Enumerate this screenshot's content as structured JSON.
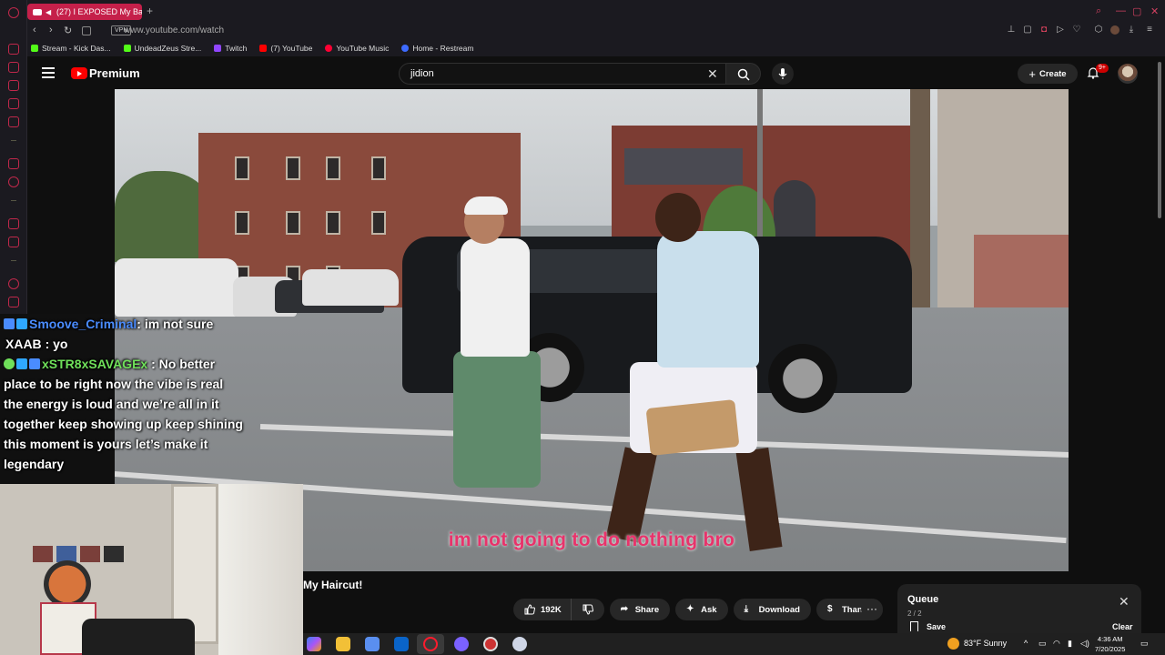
{
  "browser": {
    "tab_title": "(27) I EXPOSED My Ba",
    "url": "www.youtube.com/watch",
    "vpn_label": "VPN",
    "bookmarks": [
      {
        "label": "Stream - Kick Das...",
        "color": "#53fc18"
      },
      {
        "label": "UndeadZeus Stre...",
        "color": "#53fc18"
      },
      {
        "label": "Twitch",
        "color": "#9146ff"
      },
      {
        "label": "(7) YouTube",
        "color": "#ff0000"
      },
      {
        "label": "YouTube Music",
        "color": "#ff0033"
      },
      {
        "label": "Home - Restream",
        "color": "#3d6bff"
      }
    ]
  },
  "youtube": {
    "brand": "Premium",
    "search_value": "jidion",
    "create_label": "Create",
    "notif_badge": "9+",
    "subtitle": "im not going to do nothing bro",
    "video_title": "My Haircut!",
    "actions": {
      "likes": "192K",
      "share": "Share",
      "ask": "Ask",
      "download": "Download",
      "thanks": "Thanks",
      "more": "···"
    },
    "queue": {
      "title": "Queue",
      "count": "2 / 2",
      "save": "Save",
      "clear": "Clear"
    }
  },
  "chat": [
    {
      "user": "Smoove_Criminal",
      "message": ": im not sure",
      "user_color": "#4a8cff"
    },
    {
      "user": "XAAB",
      "message": ": yo",
      "user_color": "#ffffff"
    },
    {
      "user": "xSTR8xSAVAGEx",
      "message": ": No better place to be right now the vibe is real the energy is loud and we’re all in it together keep showing up keep shining this moment is yours let’s make it legendary",
      "user_color": "#6fe05a"
    }
  ],
  "taskbar": {
    "weather": "83°F  Sunny",
    "time": "4:36 AM",
    "date": "7/20/2025"
  },
  "colors": {
    "accent": "#c5204a",
    "subtitle": "#e8336b",
    "yt_red": "#ff0000"
  }
}
